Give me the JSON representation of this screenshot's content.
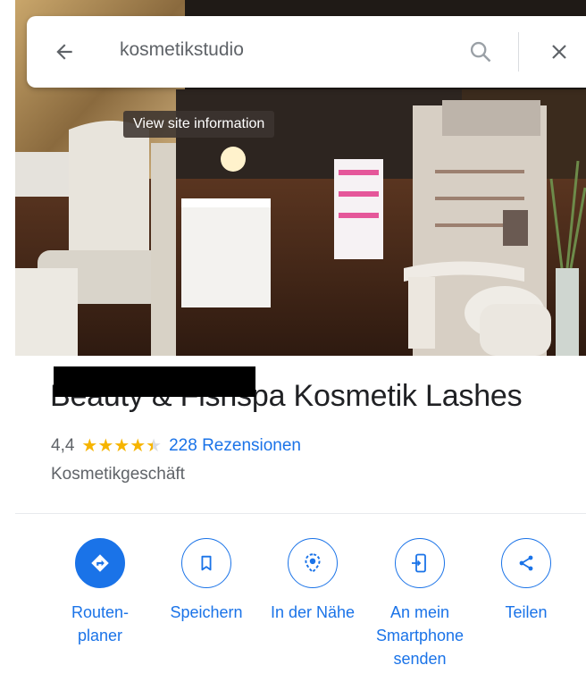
{
  "search": {
    "query": "kosmetikstudio"
  },
  "photo": {
    "tooltip": "View site information"
  },
  "place": {
    "title": "Beauty & Fishspa Kosmetik Lashes",
    "rating": "4,4",
    "rating_value": 4.4,
    "reviews": "228 Rezensionen",
    "category": "Kosmetikgeschäft"
  },
  "actions": [
    {
      "label": "Routen-\nplaner",
      "icon": "directions-icon"
    },
    {
      "label": "Speichern",
      "icon": "bookmark-icon"
    },
    {
      "label": "In der Nähe",
      "icon": "nearby-icon"
    },
    {
      "label": "An mein\nSmartphone\nsenden",
      "icon": "send-to-phone-icon"
    },
    {
      "label": "Teilen",
      "icon": "share-icon"
    }
  ],
  "colors": {
    "accent": "#1a73e8",
    "star": "#f6b400",
    "text": "#202124",
    "secondary": "#5f6368"
  }
}
